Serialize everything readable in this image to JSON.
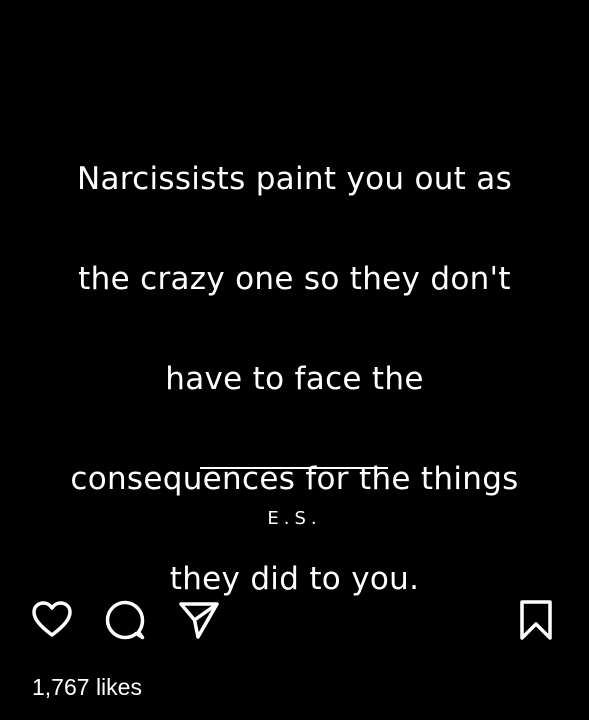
{
  "post": {
    "quote_lines": [
      "Narcissists paint you out as",
      "the crazy one so they don't",
      "have to face the",
      "consequences for the things",
      "they did to you."
    ],
    "signature": "E.S."
  },
  "actions": {
    "like_icon": "heart-outline",
    "comment_icon": "speech-bubble",
    "share_icon": "paper-plane",
    "save_icon": "bookmark-outline"
  },
  "likes_text": "1,767 likes",
  "colors": {
    "background": "#000000",
    "text": "#ffffff"
  }
}
